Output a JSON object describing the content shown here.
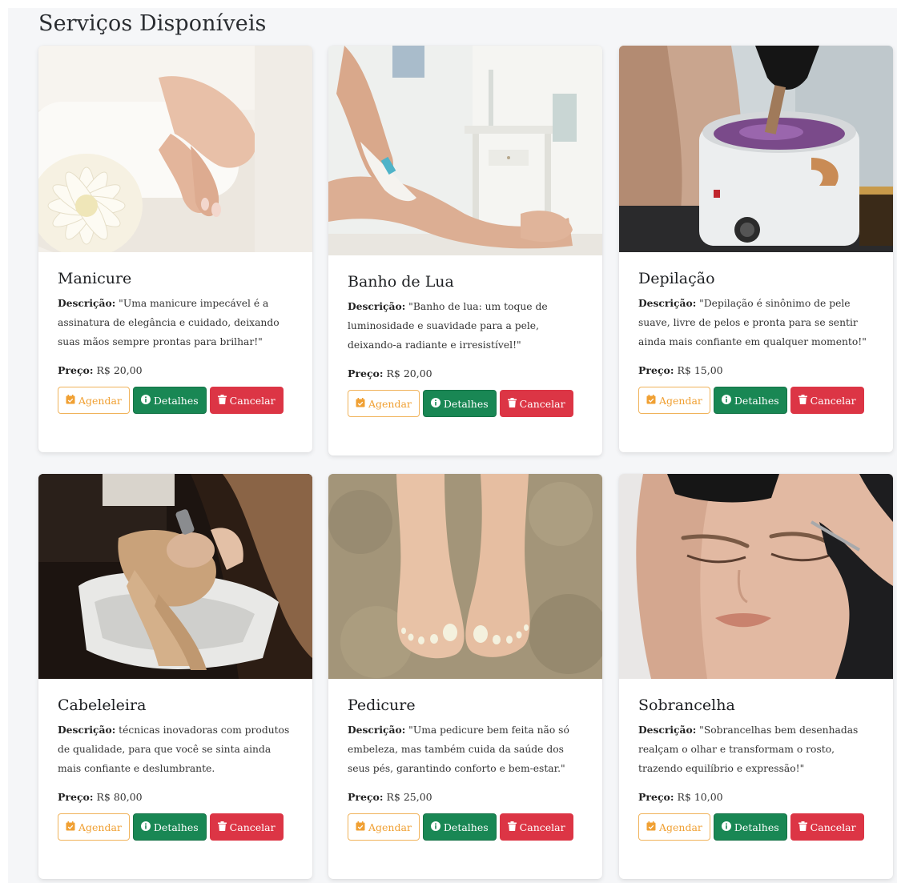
{
  "page": {
    "title": "Serviços Disponíveis"
  },
  "labels": {
    "description_label": "Descrição:",
    "price_label": "Preço:"
  },
  "buttons": {
    "schedule": "Agendar",
    "details": "Detalhes",
    "cancel": "Cancelar"
  },
  "colors": {
    "schedule_outline": "#f0a033",
    "details_bg": "#198754",
    "cancel_bg": "#dc3545"
  },
  "icons": {
    "schedule": "calendar-check-icon",
    "details": "info-circle-icon",
    "cancel": "trash-icon"
  },
  "services": [
    {
      "name": "Manicure",
      "description": "\"Uma manicure impecável é a assinatura de elegância e cuidado, deixando suas mãos sempre prontas para brilhar!\"",
      "price": "R$ 20,00"
    },
    {
      "name": "Banho de Lua",
      "description": "\"Banho de lua: um toque de luminosidade e suavidade para a pele, deixando-a radiante e irresistível!\"",
      "price": "R$ 20,00"
    },
    {
      "name": "Depilação",
      "description": "\"Depilação é sinônimo de pele suave, livre de pelos e pronta para se sentir ainda mais confiante em qualquer momento!\"",
      "price": "R$ 15,00"
    },
    {
      "name": "Cabeleleira",
      "description": "técnicas inovadoras com produtos de qualidade, para que você se sinta ainda mais confiante e deslumbrante.",
      "price": "R$ 80,00"
    },
    {
      "name": "Pedicure",
      "description": "\"Uma pedicure bem feita não só embeleza, mas também cuida da saúde dos seus pés, garantindo conforto e bem-estar.\"",
      "price": "R$ 25,00"
    },
    {
      "name": "Sobrancelha",
      "description": "\"Sobrancelhas bem desenhadas realçam o olhar e transformam o rosto, trazendo equilíbrio e expressão!\"",
      "price": "R$ 10,00"
    }
  ]
}
